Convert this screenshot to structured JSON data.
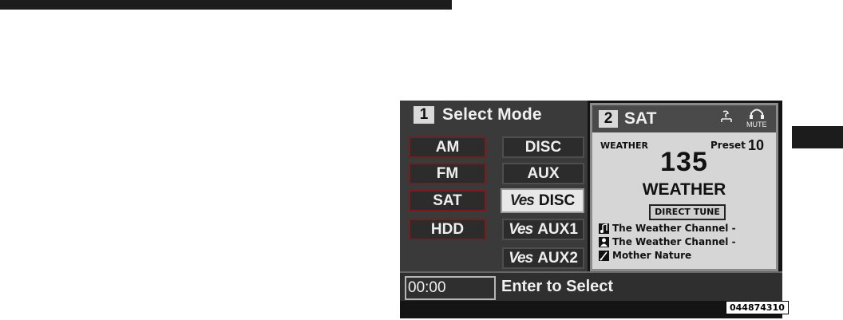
{
  "left_panel": {
    "number": "1",
    "title": "Select Mode",
    "buttons": {
      "am": "AM",
      "fm": "FM",
      "sat": "SAT",
      "hdd": "HDD",
      "disc": "DISC",
      "aux": "AUX",
      "ves_disc": {
        "prefix": "Ves",
        "label": "DISC"
      },
      "ves_aux1": {
        "prefix": "Ves",
        "label": "AUX1"
      },
      "ves_aux2": {
        "prefix": "Ves",
        "label": "AUX2"
      }
    },
    "selected": "ves_disc"
  },
  "right_panel": {
    "number": "2",
    "title": "SAT",
    "mute_label": "MUTE",
    "category": "WEATHER",
    "preset_label": "Preset",
    "preset_number": "10",
    "channel_number": "135",
    "channel_name": "WEATHER",
    "direct_tune": "DIRECT TUNE",
    "song_line": "The Weather Channel -",
    "artist_line": "The Weather Channel -",
    "composer_line": "Mother Nature"
  },
  "bottom_bar": {
    "time": "00:00",
    "hint": "Enter to Select"
  },
  "image_code": "044874310",
  "icons": {
    "music_note": "music-note-icon",
    "artist": "artist-icon",
    "composer": "composer-icon",
    "headphones": "headphones-icon",
    "signal": "signal-icon"
  }
}
